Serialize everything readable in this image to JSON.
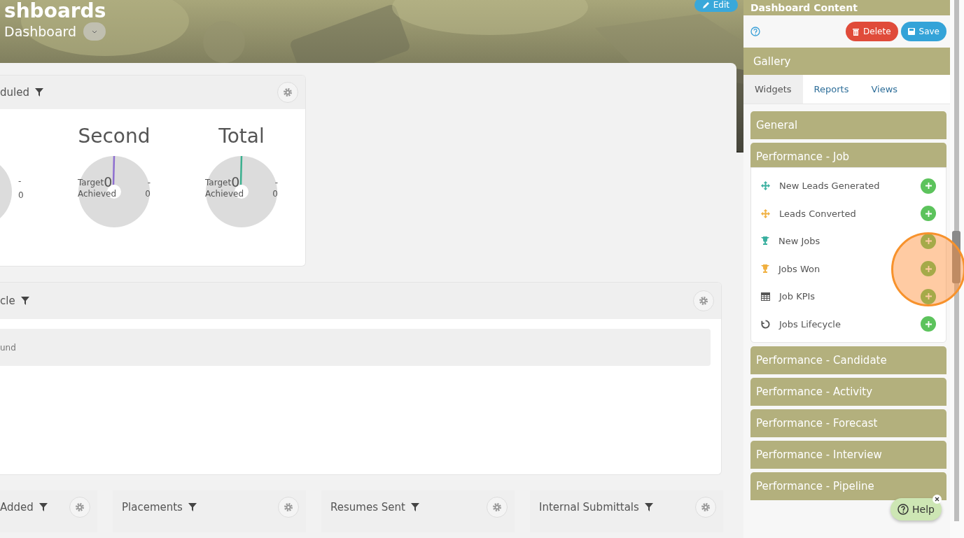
{
  "header": {
    "title": "shboards",
    "dashboard_name": "Dashboard",
    "edit_button": "Edit"
  },
  "widgets": [
    {
      "kind": "gauges",
      "title": "duled",
      "gauges": [
        {
          "kind": "partial",
          "target_value": "-",
          "achieved_value": "0"
        },
        {
          "kind": "full",
          "title": "Second",
          "color": "#8e6fd0",
          "target_label": "Target",
          "center_value": "0",
          "target_value": "-",
          "achieved_label": "Achieved",
          "achieved_value": "0"
        },
        {
          "kind": "full",
          "title": "Total",
          "color": "#3bb08f",
          "target_label": "Target",
          "center_value": "0",
          "target_value": "-",
          "achieved_label": "Achieved",
          "achieved_value": "0"
        }
      ]
    },
    {
      "kind": "message",
      "title": "cle",
      "message": "und"
    }
  ],
  "small_widgets": [
    {
      "title": "Added"
    },
    {
      "title": "Placements"
    },
    {
      "title": "Resumes Sent"
    },
    {
      "title": "Internal Submittals"
    }
  ],
  "panel": {
    "title": "Dashboard Content",
    "buttons": [
      {
        "label": "Delete",
        "kind": "danger"
      },
      {
        "label": "Save",
        "kind": "primary"
      }
    ],
    "gallery": {
      "title": "Gallery",
      "tabs": [
        {
          "label": "Widgets",
          "selected": true
        },
        {
          "label": "Reports",
          "selected": false
        },
        {
          "label": "Views",
          "selected": false
        }
      ],
      "sections": [
        {
          "title": "General",
          "expanded": false
        },
        {
          "title": "Performance - Job",
          "expanded": true,
          "items": [
            {
              "label": "New Leads Generated",
              "kind": "move",
              "color": "#3bb0a0"
            },
            {
              "label": "Leads Converted",
              "kind": "move",
              "color": "#f0b040"
            },
            {
              "label": "New Jobs",
              "kind": "trophy",
              "color": "#3bb0a0"
            },
            {
              "label": "Jobs Won",
              "kind": "trophy",
              "color": "#f0b040"
            },
            {
              "label": "Job KPIs",
              "kind": "table",
              "color": "#555555"
            },
            {
              "label": "Jobs Lifecycle",
              "kind": "cycle",
              "color": "#555555"
            }
          ]
        },
        {
          "title": "Performance - Candidate",
          "expanded": false
        },
        {
          "title": "Performance - Activity",
          "expanded": false
        },
        {
          "title": "Performance - Forecast",
          "expanded": false
        },
        {
          "title": "Performance - Interview",
          "expanded": false
        },
        {
          "title": "Performance - Pipeline",
          "expanded": false
        }
      ]
    }
  },
  "help": {
    "label": "Help"
  }
}
